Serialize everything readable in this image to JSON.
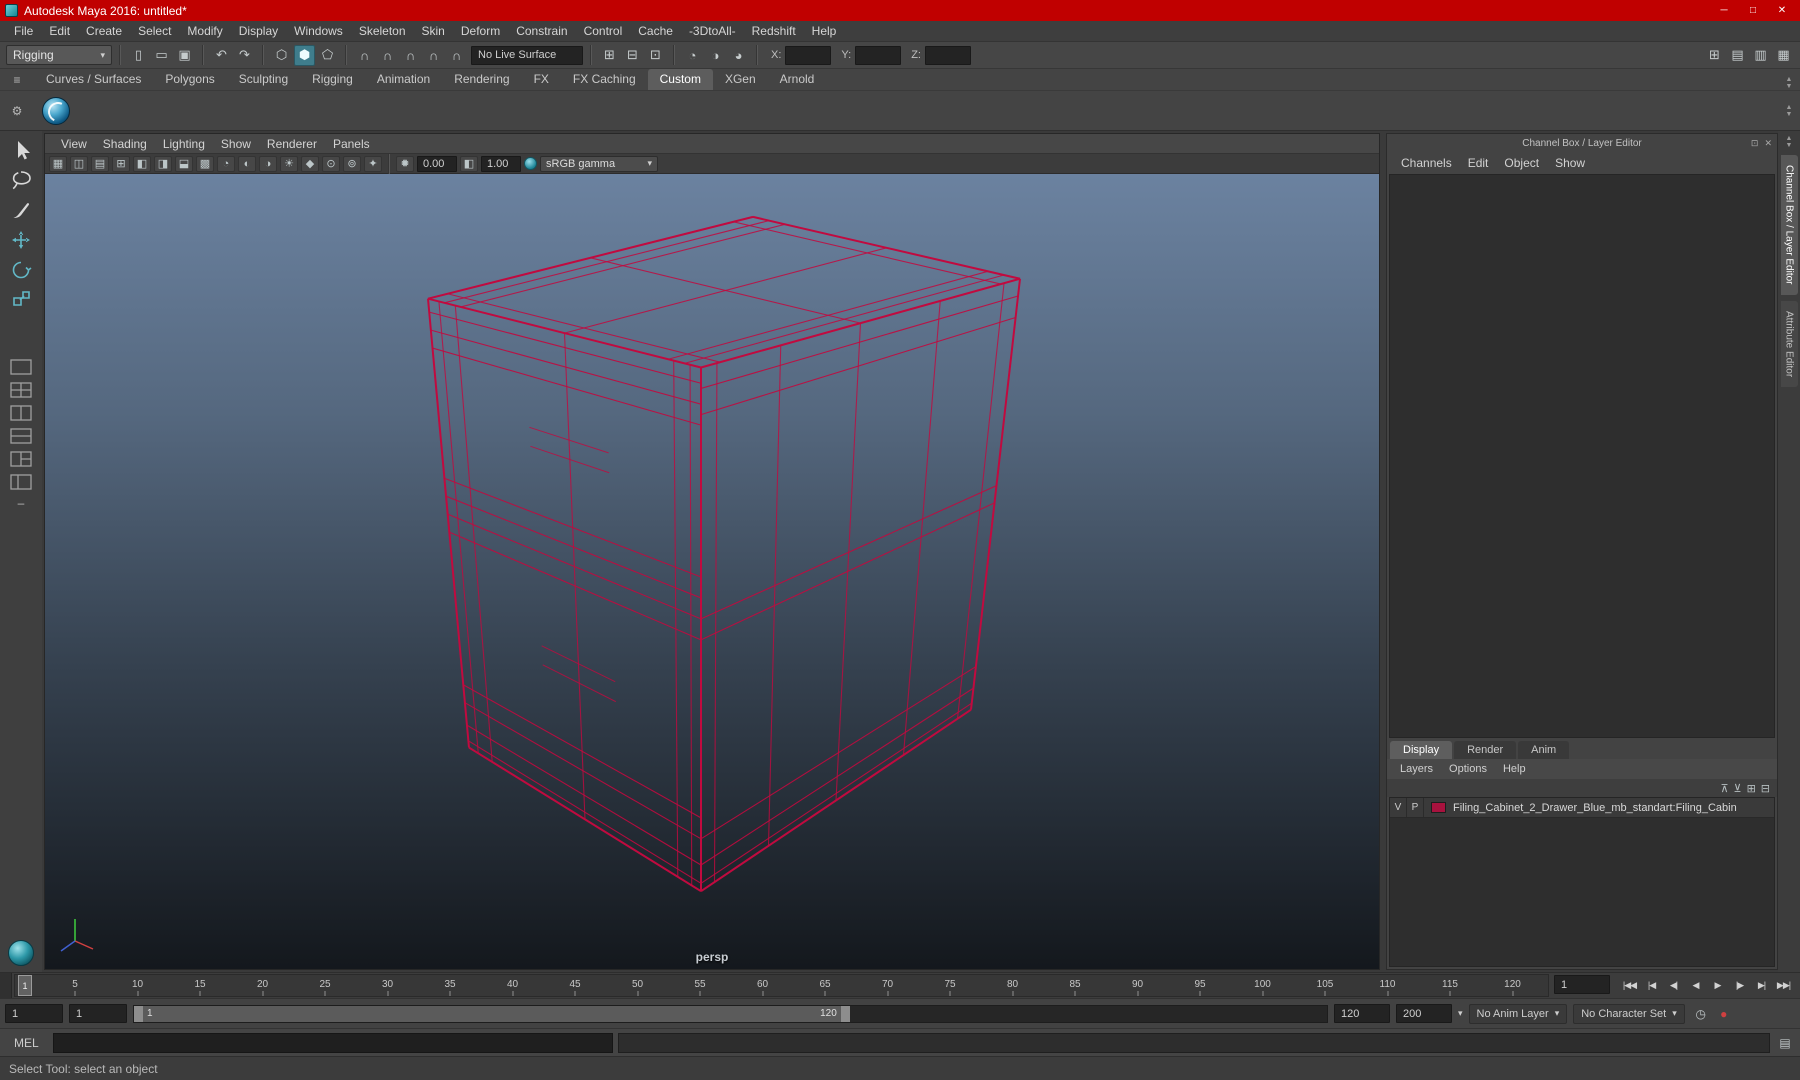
{
  "window": {
    "title": "Autodesk Maya 2016: untitled*",
    "buttons": {
      "minimize": "─",
      "restore": "□",
      "close": "✕"
    }
  },
  "menu_bar": {
    "items": [
      "File",
      "Edit",
      "Create",
      "Select",
      "Modify",
      "Display",
      "Windows",
      "Skeleton",
      "Skin",
      "Deform",
      "Constrain",
      "Control",
      "Cache",
      "-3DtoAll-",
      "Redshift",
      "Help"
    ]
  },
  "toolbar": {
    "mode": "Rigging",
    "live_surface": "No Live Surface",
    "axis": {
      "x": "X:",
      "y": "Y:",
      "z": "Z:"
    },
    "groups": {
      "file_icons": [
        {
          "name": "new-scene-icon",
          "glyph": "▯"
        },
        {
          "name": "open-scene-icon",
          "glyph": "▭"
        },
        {
          "name": "save-scene-icon",
          "glyph": "▣"
        }
      ],
      "undo_icons": [
        {
          "name": "undo-icon",
          "glyph": "↶"
        },
        {
          "name": "redo-icon",
          "glyph": "↷"
        }
      ],
      "select_icons": [
        {
          "name": "select-hierarchy-icon",
          "glyph": "⬡"
        },
        {
          "name": "select-object-icon",
          "glyph": "⬢",
          "active": true
        },
        {
          "name": "select-component-icon",
          "glyph": "⬠"
        }
      ],
      "snap_icons": [
        {
          "name": "snap-to-grid-icon",
          "glyph": "∩"
        },
        {
          "name": "snap-to-curve-icon",
          "glyph": "∩"
        },
        {
          "name": "snap-to-point-icon",
          "glyph": "∩"
        },
        {
          "name": "snap-to-plane-icon",
          "glyph": "∩"
        },
        {
          "name": "make-live-icon",
          "glyph": "∩"
        }
      ],
      "history_icons": [
        {
          "name": "input-operations-icon",
          "glyph": "⊞"
        },
        {
          "name": "output-operations-icon",
          "glyph": "⊟"
        },
        {
          "name": "construction-history-icon",
          "glyph": "⊡"
        }
      ],
      "render_icons": [
        {
          "name": "open-render-view-icon",
          "glyph": "◔"
        },
        {
          "name": "render-current-frame-icon",
          "glyph": "◑"
        },
        {
          "name": "render-settings-icon",
          "glyph": "◕"
        }
      ],
      "right_icons": [
        {
          "name": "show-grid-toggle-icon",
          "glyph": "⊞"
        },
        {
          "name": "outliner-toggle-icon",
          "glyph": "▤"
        },
        {
          "name": "channel-box-toggle-icon",
          "glyph": "▥"
        },
        {
          "name": "layout-toggle-icon",
          "glyph": "▦"
        }
      ]
    }
  },
  "shelf": {
    "tabs": [
      "Curves / Surfaces",
      "Polygons",
      "Sculpting",
      "Rigging",
      "Animation",
      "Rendering",
      "FX",
      "FX Caching",
      "Custom",
      "XGen",
      "Arnold"
    ],
    "active_tab": "Custom",
    "hamburger_glyph": "≡",
    "gear_glyph": "⚙",
    "scroll_up": "▲",
    "scroll_down": "▼"
  },
  "toolbox": {
    "tools": [
      {
        "name": "select-tool"
      },
      {
        "name": "lasso-tool"
      },
      {
        "name": "paint-select-tool"
      },
      {
        "name": "move-tool"
      },
      {
        "name": "rotate-tool"
      },
      {
        "name": "scale-tool"
      }
    ],
    "layouts": [
      {
        "name": "layout-single-pane",
        "kind": "single"
      },
      {
        "name": "layout-four-pane",
        "kind": "four"
      },
      {
        "name": "layout-two-pane-side-by-side",
        "kind": "two-side"
      },
      {
        "name": "layout-two-pane-stacked",
        "kind": "two-stacked"
      },
      {
        "name": "layout-three-pane-split",
        "kind": "three"
      },
      {
        "name": "layout-outliner-persp",
        "kind": "outliner"
      }
    ],
    "minus_label": "–"
  },
  "viewport": {
    "menus": [
      "View",
      "Shading",
      "Lighting",
      "Show",
      "Renderer",
      "Panels"
    ],
    "icons": [
      {
        "name": "select-camera-icon",
        "glyph": "▦"
      },
      {
        "name": "lock-camera-icon",
        "glyph": "◫"
      },
      {
        "name": "camera-attributes-icon",
        "glyph": "▤"
      },
      {
        "name": "bookmarks-icon",
        "glyph": "⊞"
      },
      {
        "name": "image-plane-icon",
        "glyph": "◧"
      },
      {
        "name": "two-d-pan-zoom-icon",
        "glyph": "◨"
      },
      {
        "name": "grease-pencil-icon",
        "glyph": "⬓"
      },
      {
        "name": "grid-toggle-icon",
        "glyph": "▩"
      },
      {
        "name": "film-gate-icon",
        "glyph": "◔"
      },
      {
        "name": "resolution-gate-icon",
        "glyph": "◐"
      },
      {
        "name": "gate-mask-icon",
        "glyph": "◑"
      },
      {
        "name": "lighting-toggle-icon",
        "glyph": "☀"
      },
      {
        "name": "shadows-toggle-icon",
        "glyph": "◆"
      },
      {
        "name": "screen-space-ao-icon",
        "glyph": "⊙"
      },
      {
        "name": "motion-blur-icon",
        "glyph": "⊚"
      },
      {
        "name": "multisampling-icon",
        "glyph": "✦"
      }
    ],
    "exposure": "0.00",
    "gamma": "1.00",
    "exposure_icon_glyph": "✹",
    "gamma_icon_glyph": "◧",
    "color_space": "sRGB gamma",
    "camera": "persp"
  },
  "channel_box": {
    "title": "Channel Box / Layer Editor",
    "menus": [
      "Channels",
      "Edit",
      "Object",
      "Show"
    ],
    "header_icons": [
      {
        "name": "dock-panel-icon",
        "glyph": "⊡"
      },
      {
        "name": "close-panel-icon",
        "glyph": "✕"
      }
    ]
  },
  "layer_editor": {
    "tabs": [
      "Display",
      "Render",
      "Anim"
    ],
    "active_tab": "Display",
    "menus": [
      "Layers",
      "Options",
      "Help"
    ],
    "toolbar_icons": [
      {
        "name": "move-layer-up-icon",
        "glyph": "⊼"
      },
      {
        "name": "move-layer-down-icon",
        "glyph": "⊻"
      },
      {
        "name": "create-empty-layer-icon",
        "glyph": "⊞"
      },
      {
        "name": "create-layer-from-selected-icon",
        "glyph": "⊟"
      }
    ],
    "layers": [
      {
        "visible": "V",
        "playback": "P",
        "color": "#a8123e",
        "name": "Filing_Cabinet_2_Drawer_Blue_mb_standart:Filing_Cabin"
      }
    ]
  },
  "side_tabs": [
    {
      "label": "Channel Box / Layer Editor",
      "active": true
    },
    {
      "label": "Attribute Editor",
      "active": false
    }
  ],
  "timeline": {
    "ticks": [
      5,
      10,
      15,
      20,
      25,
      30,
      35,
      40,
      45,
      50,
      55,
      60,
      65,
      70,
      75,
      80,
      85,
      90,
      95,
      100,
      105,
      110,
      115,
      120
    ],
    "current_frame": "1",
    "playback_buttons": [
      {
        "name": "go-to-start-button",
        "glyph": "|◀◀"
      },
      {
        "name": "step-back-key-button",
        "glyph": "|◀"
      },
      {
        "name": "step-back-frame-button",
        "glyph": "◀|"
      },
      {
        "name": "play-backwards-button",
        "glyph": "◀"
      },
      {
        "name": "play-forwards-button",
        "glyph": "▶"
      },
      {
        "name": "step-forward-frame-button",
        "glyph": "|▶"
      },
      {
        "name": "step-forward-key-button",
        "glyph": "▶|"
      },
      {
        "name": "go-to-end-button",
        "glyph": "▶▶|"
      }
    ]
  },
  "range_slider": {
    "animation_start": "1",
    "playback_start": "1",
    "bar_start": "1",
    "bar_end": "120",
    "playback_end": "120",
    "animation_end": "200",
    "anim_layer": "No Anim Layer",
    "character_set": "No Character Set",
    "icons": [
      {
        "name": "playback-options-icon",
        "glyph": "◷",
        "color": "#c0c6c8"
      },
      {
        "name": "auto-keyframe-toggle-icon",
        "glyph": "●",
        "color": "#cf4040"
      }
    ]
  },
  "command_line": {
    "label": "MEL",
    "script_editor_glyph": "▤"
  },
  "help_line": {
    "text": "Select Tool: select an object"
  },
  "colors": {
    "titlebar": "#c00000",
    "wireframe": "#c10a3f",
    "viewport_top": "#6b82a0",
    "viewport_bottom": "#14181d",
    "accent_teal": "#62b8c7"
  }
}
